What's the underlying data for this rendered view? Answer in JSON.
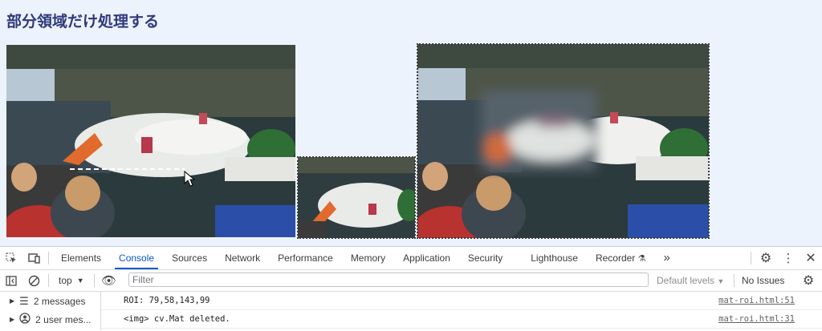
{
  "page": {
    "title": "部分領域だけ処理する"
  },
  "devtools": {
    "tabs": [
      {
        "label": "Elements"
      },
      {
        "label": "Console"
      },
      {
        "label": "Sources"
      },
      {
        "label": "Network"
      },
      {
        "label": "Performance"
      },
      {
        "label": "Memory"
      },
      {
        "label": "Application"
      },
      {
        "label": "Security"
      },
      {
        "label": "Lighthouse"
      },
      {
        "label": "Recorder"
      }
    ],
    "active_tab": "Console",
    "more_tabs_glyph": "»",
    "toolbar": {
      "context": "top",
      "filter_placeholder": "Filter",
      "levels": "Default levels",
      "issues": "No Issues"
    },
    "sidebar": [
      {
        "label": "2 messages",
        "icon": "list-icon"
      },
      {
        "label": "2 user mes...",
        "icon": "user-icon"
      }
    ],
    "messages": [
      {
        "text": "ROI: 79,58,143,99",
        "source": "mat-roi.html:51"
      },
      {
        "text": "<img> cv.Mat deleted.",
        "source": "mat-roi.html:31"
      }
    ]
  }
}
